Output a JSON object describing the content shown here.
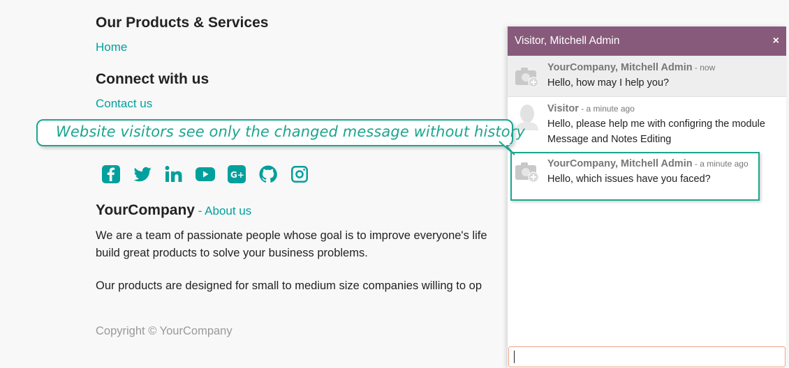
{
  "footer": {
    "products_heading": "Our Products & Services",
    "home_link": "Home",
    "connect_heading": "Connect with us",
    "contact_link": "Contact us",
    "social_icons": [
      "facebook-icon",
      "twitter-icon",
      "linkedin-icon",
      "youtube-icon",
      "google-plus-icon",
      "github-icon",
      "instagram-icon"
    ],
    "company_name": "YourCompany",
    "company_sep": " - ",
    "about_link": "About us",
    "about_text_1": "We are a team of passionate people whose goal is to improve everyone's life",
    "about_text_2": "build great products to solve your business problems.",
    "about_text_3": "Our products are designed for small to medium size companies willing to op",
    "copyright": "Copyright © YourCompany"
  },
  "callout": {
    "text": "Website visitors see only the changed message without history"
  },
  "chat": {
    "title": "Visitor, Mitchell Admin",
    "close": "×",
    "messages": [
      {
        "author": "YourCompany, Mitchell Admin",
        "time": " - now",
        "text": "Hello, how may I help you?"
      },
      {
        "author": "Visitor",
        "time": " - a minute ago",
        "text_1": "Hello, please help me with configring the module",
        "text_2": "Message and Notes Editing"
      },
      {
        "author": "YourCompany, Mitchell Admin",
        "time": " - a minute ago",
        "text": "Hello, which issues have you faced?"
      }
    ],
    "input_value": ""
  },
  "colors": {
    "accent": "#00a09d",
    "callout": "#1aa68f",
    "header": "#875a7b"
  }
}
